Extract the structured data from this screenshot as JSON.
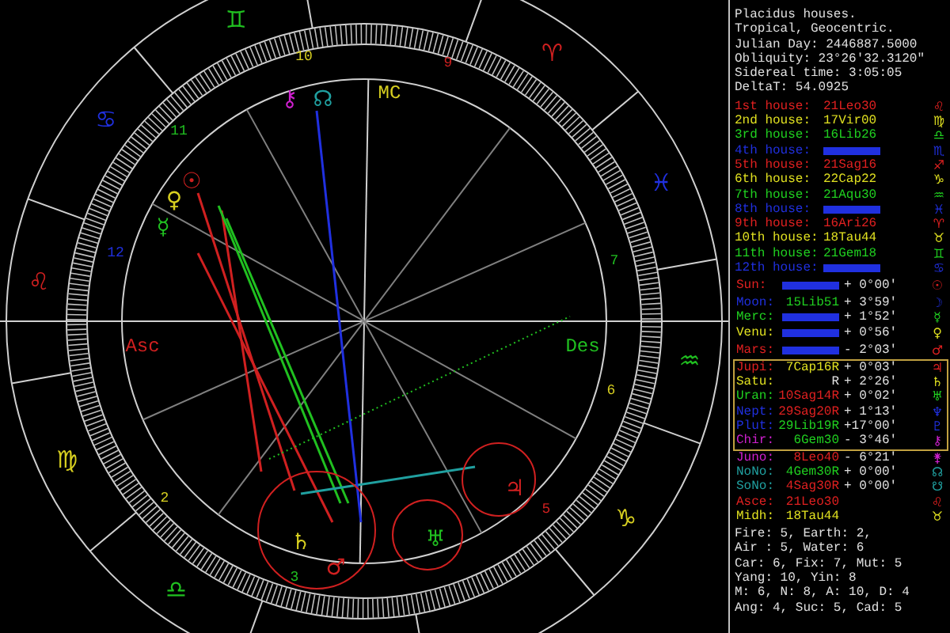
{
  "chart": {
    "signs": [
      {
        "glyph": "♊",
        "color": "#20c020"
      },
      {
        "glyph": "♈",
        "color": "#d02020"
      },
      {
        "glyph": "♓",
        "color": "#2030e0"
      },
      {
        "glyph": "♒",
        "color": "#20c020"
      },
      {
        "glyph": "♑",
        "color": "#d8d020"
      },
      {
        "glyph": "♎",
        "color": "#20c020"
      },
      {
        "glyph": "♍",
        "color": "#d8d020"
      },
      {
        "glyph": "♌",
        "color": "#d02020"
      },
      {
        "glyph": "♋",
        "color": "#2030e0"
      }
    ],
    "angles": [
      {
        "label": "Asc",
        "color": "#d02020"
      },
      {
        "label": "MC",
        "color": "#d8d020"
      },
      {
        "label": "Des",
        "color": "#20c020"
      }
    ],
    "house_numbers": [
      {
        "label": "10",
        "color": "#d8d020"
      },
      {
        "label": "11",
        "color": "#20c020"
      },
      {
        "label": "12",
        "color": "#2030e0"
      },
      {
        "label": "2",
        "color": "#d8d020"
      },
      {
        "label": "3",
        "color": "#20c020"
      },
      {
        "label": "5",
        "color": "#d02020"
      },
      {
        "label": "6",
        "color": "#d8d020"
      },
      {
        "label": "7",
        "color": "#20c020"
      },
      {
        "label": "9",
        "color": "#d02020"
      }
    ],
    "planets": [
      {
        "glyph": "☉",
        "color": "#d02020"
      },
      {
        "glyph": "♀",
        "color": "#d8d020"
      },
      {
        "glyph": "☿",
        "color": "#20c020"
      },
      {
        "glyph": "⚷",
        "color": "#d020d0"
      },
      {
        "glyph": "☊",
        "color": "#20a0a0"
      },
      {
        "glyph": "♄",
        "color": "#d8d020"
      },
      {
        "glyph": "♂",
        "color": "#d02020"
      },
      {
        "glyph": "♅",
        "color": "#20c020"
      },
      {
        "glyph": "♃",
        "color": "#d02020"
      }
    ]
  },
  "info": {
    "header_lines": [
      "Placidus houses.",
      "Tropical, Geocentric.",
      "Julian Day: 2446887.5000",
      "Obliquity: 23°26'32.3120\"",
      "Sidereal time: 3:05:05",
      "DeltaT: 54.0925"
    ],
    "houses": [
      {
        "label": "1st house:",
        "value": "21Leo30",
        "color": "#e02020",
        "symbol": "♌"
      },
      {
        "label": "2nd house:",
        "value": "17Vir00",
        "color": "#e0e020",
        "symbol": "♍"
      },
      {
        "label": "3rd house:",
        "value": "16Lib26",
        "color": "#20d020",
        "symbol": "♎"
      },
      {
        "label": "4th house:",
        "color": "#2030e0",
        "symbol": "♏"
      },
      {
        "label": "5th house:",
        "value": "21Sag16",
        "color": "#e02020",
        "symbol": "♐"
      },
      {
        "label": "6th house:",
        "value": "22Cap22",
        "color": "#e0e020",
        "symbol": "♑"
      },
      {
        "label": "7th house:",
        "value": "21Aqu30",
        "color": "#20d020",
        "symbol": "♒"
      },
      {
        "label": "8th house:",
        "color": "#2030e0",
        "symbol": "♓"
      },
      {
        "label": "9th house:",
        "value": "16Ari26",
        "color": "#e02020",
        "symbol": "♈"
      },
      {
        "label": "10th house:",
        "value": "18Tau44",
        "color": "#e0e020",
        "symbol": "♉"
      },
      {
        "label": "11th house:",
        "value": "21Gem18",
        "color": "#20d020",
        "symbol": "♊"
      },
      {
        "label": "12th house:",
        "color": "#2030e0",
        "symbol": "♋"
      }
    ],
    "bodies": [
      {
        "label": "Sun:",
        "color": "#e02020",
        "position": {
          "color": "#2030e0"
        },
        "offset": "+ 0°00'",
        "symbol": "☉",
        "boxed": false
      },
      {
        "label": "Moon:",
        "color": "#2030e0",
        "position": {
          "text": "15Lib51",
          "color": "#20d020"
        },
        "offset": "+ 3°59'",
        "symbol": "☽",
        "boxed": false
      },
      {
        "label": "Merc:",
        "color": "#20d020",
        "position": {
          "color": "#2030e0"
        },
        "offset": "+ 1°52'",
        "symbol": "☿",
        "boxed": false
      },
      {
        "label": "Venu:",
        "color": "#e0e020",
        "position": {
          "color": "#2030e0"
        },
        "offset": "+ 0°56'",
        "symbol": "♀",
        "boxed": false
      },
      {
        "label": "Mars:",
        "color": "#e02020",
        "position": {
          "color": "#2030e0"
        },
        "offset": "- 2°03'",
        "symbol": "♂",
        "boxed": false
      },
      {
        "label": "Jupi:",
        "color": "#e02020",
        "position": {
          "text": "7Cap16R",
          "color": "#e0e020"
        },
        "offset": "+ 0°03'",
        "symbol": "♃",
        "boxed": true
      },
      {
        "label": "Satu:",
        "color": "#e0e020",
        "position": {
          "text": "R",
          "color": "#e0e0e0"
        },
        "offset": "+ 2°26'",
        "symbol": "♄",
        "boxed": true
      },
      {
        "label": "Uran:",
        "color": "#20d020",
        "position": {
          "text": "10Sag14R",
          "color": "#e02020"
        },
        "offset": "+ 0°02'",
        "symbol": "♅",
        "boxed": true
      },
      {
        "label": "Nept:",
        "color": "#2030e0",
        "position": {
          "text": "29Sag20R",
          "color": "#e02020"
        },
        "offset": "+ 1°13'",
        "symbol": "♆",
        "boxed": true
      },
      {
        "label": "Plut:",
        "color": "#2030e0",
        "position": {
          "text": "29Lib19R",
          "color": "#20d020"
        },
        "offset": "+17°00'",
        "symbol": "♇",
        "boxed": true
      },
      {
        "label": "Chir:",
        "color": "#d020d0",
        "position": {
          "text": "6Gem30",
          "color": "#20d020"
        },
        "offset": "- 3°46'",
        "symbol": "⚷",
        "boxed": true
      },
      {
        "label": "Juno:",
        "color": "#d020d0",
        "position": {
          "text": "8Leo40",
          "color": "#e02020"
        },
        "offset": "- 6°21'",
        "symbol": "⚵",
        "boxed": false
      },
      {
        "label": "NoNo:",
        "color": "#20a0a0",
        "position": {
          "text": "4Gem30R",
          "color": "#20d020"
        },
        "offset": "+ 0°00'",
        "symbol": "☊",
        "boxed": false
      },
      {
        "label": "SoNo:",
        "color": "#20a0a0",
        "position": {
          "text": "4Sag30R",
          "color": "#e02020"
        },
        "offset": "+ 0°00'",
        "symbol": "☋",
        "boxed": false
      },
      {
        "label": "Asce:",
        "color": "#e02020",
        "position": {
          "text": "21Leo30",
          "color": "#e02020"
        },
        "symbol": "♌",
        "boxed": false
      },
      {
        "label": "Midh:",
        "color": "#e0e020",
        "position": {
          "text": "18Tau44",
          "color": "#e0e020"
        },
        "symbol": "♉",
        "boxed": false
      }
    ],
    "summary_lines": [
      "Fire: 5, Earth: 2,",
      "Air : 5, Water: 6",
      "Car: 6, Fix: 7, Mut: 5",
      "Yang: 10, Yin: 8",
      "M: 6, N: 8, A: 10, D: 4",
      "Ang: 4, Suc: 5, Cad: 5"
    ]
  }
}
